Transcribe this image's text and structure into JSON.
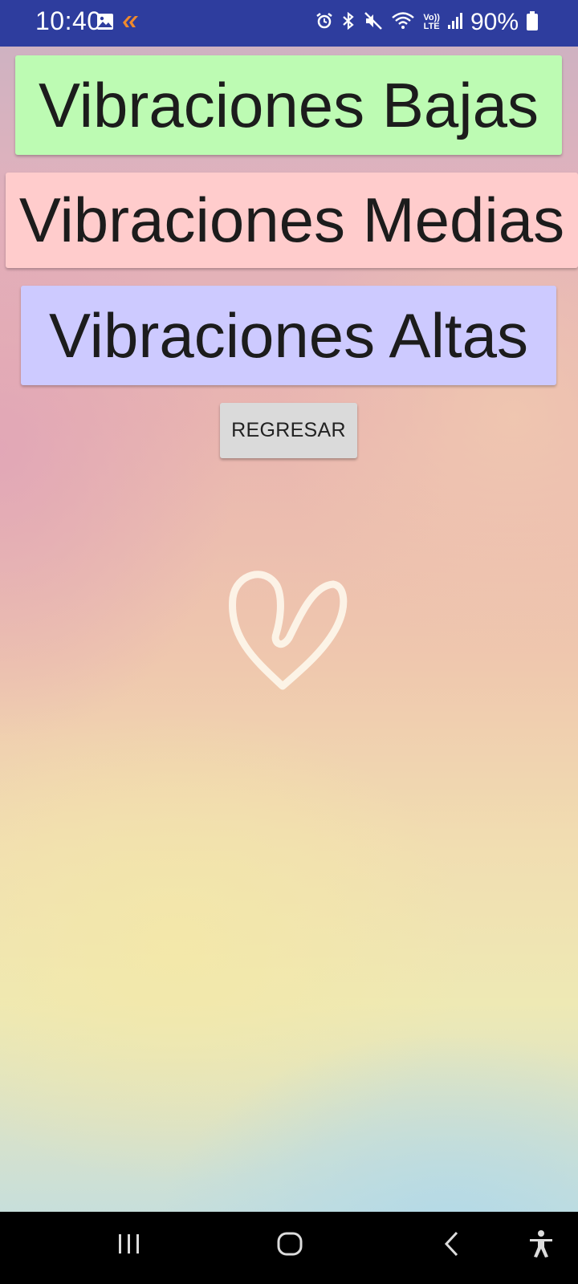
{
  "status_bar": {
    "time": "10:40",
    "battery": "90%",
    "icons": [
      "image-icon",
      "app-notification-icon",
      "alarm-icon",
      "bluetooth-icon",
      "mute-icon",
      "wifi-icon",
      "volte-icon",
      "signal-icon",
      "battery-icon"
    ],
    "volte_line1": "Vo))",
    "volte_line2": "LTE"
  },
  "main": {
    "buttons": [
      {
        "label": "Vibraciones Bajas",
        "color": "#bdfbb3"
      },
      {
        "label": "Vibraciones Medias",
        "color": "#ffcccc"
      },
      {
        "label": "Vibraciones Altas",
        "color": "#cdcaff"
      }
    ],
    "back_button": {
      "label": "REGRESAR",
      "color": "#dadada"
    },
    "decoration": "heart-icon"
  },
  "nav_bar": {
    "items": [
      "recent-apps-icon",
      "home-icon",
      "back-icon",
      "accessibility-icon"
    ]
  },
  "colors": {
    "status_bar": "#2e3d9e",
    "nav_bar": "#000000",
    "text": "#1c1c1c"
  }
}
